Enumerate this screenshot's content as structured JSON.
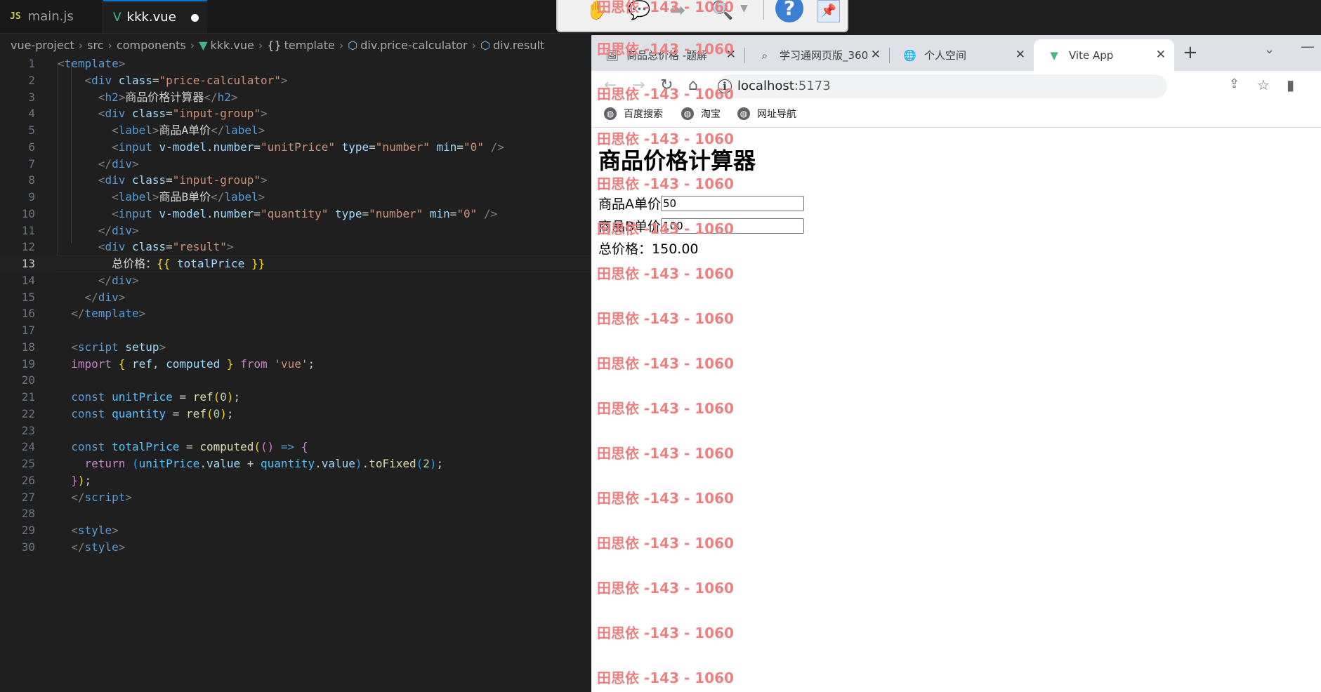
{
  "editor": {
    "tabs": [
      {
        "badge": "JS",
        "label": "main.js"
      },
      {
        "badge": "V",
        "label": "kkk.vue"
      }
    ],
    "breadcrumb": [
      "vue-project",
      "src",
      "components",
      "kkk.vue",
      "template",
      "div.price-calculator",
      "div.result"
    ],
    "line_numbers": [
      "1",
      "2",
      "3",
      "4",
      "5",
      "6",
      "7",
      "8",
      "9",
      "10",
      "11",
      "12",
      "13",
      "14",
      "15",
      "16",
      "17",
      "18",
      "19",
      "20",
      "21",
      "22",
      "23",
      "24",
      "25",
      "26",
      "27",
      "28",
      "29",
      "30"
    ],
    "active_line": "13",
    "code": {
      "tag_template": "template",
      "tag_div": "div",
      "tag_h2": "h2",
      "tag_label": "label",
      "tag_input": "input",
      "tag_script": "script",
      "tag_style": "style",
      "attr_class": "class",
      "attr_setup": "setup",
      "attr_vmodel": "v-model.number",
      "attr_type": "type",
      "attr_min": "min",
      "val_price_calculator": "\"price-calculator\"",
      "val_input_group": "\"input-group\"",
      "val_result": "\"result\"",
      "val_unitPrice": "\"unitPrice\"",
      "val_quantity": "\"quantity\"",
      "val_number": "\"number\"",
      "val_zero": "\"0\"",
      "h2_text": "商品价格计算器",
      "label_a": "商品A单价",
      "label_b": "商品B单价",
      "result_text": "总价格：",
      "interp_open": "{{",
      "interp_var": "totalPrice",
      "interp_close": "}}",
      "kw_import": "import",
      "kw_from": "from",
      "kw_const": "const",
      "kw_return": "return",
      "str_vue": "'vue'",
      "id_ref": "ref",
      "id_computed": "computed",
      "id_unitPrice": "unitPrice",
      "id_quantity": "quantity",
      "id_totalPrice": "totalPrice",
      "id_value": "value",
      "id_toFixed": "toFixed",
      "num_0": "0",
      "num_2": "2"
    }
  },
  "browser": {
    "tabs": [
      {
        "label": "商品总价格 -题解"
      },
      {
        "label": "学习通网页版_360"
      },
      {
        "label": "个人空间"
      },
      {
        "label": "Vite App"
      }
    ],
    "url_host": "localhost",
    "url_port": ":5173",
    "bookmarks": [
      "百度搜索",
      "淘宝",
      "网址导航"
    ],
    "page": {
      "heading": "商品价格计算器",
      "label_a": "商品A单价",
      "value_a": "50",
      "label_b": "商品B单价",
      "value_b": "100",
      "result_label": "总价格：",
      "result_value": "150.00"
    }
  },
  "watermark": "田思依 -143 - 1060",
  "colors": {
    "editor_bg": "#1f1f1f",
    "accent": "#0078d4",
    "watermark": "#f08080",
    "vue_green": "#41b883"
  }
}
